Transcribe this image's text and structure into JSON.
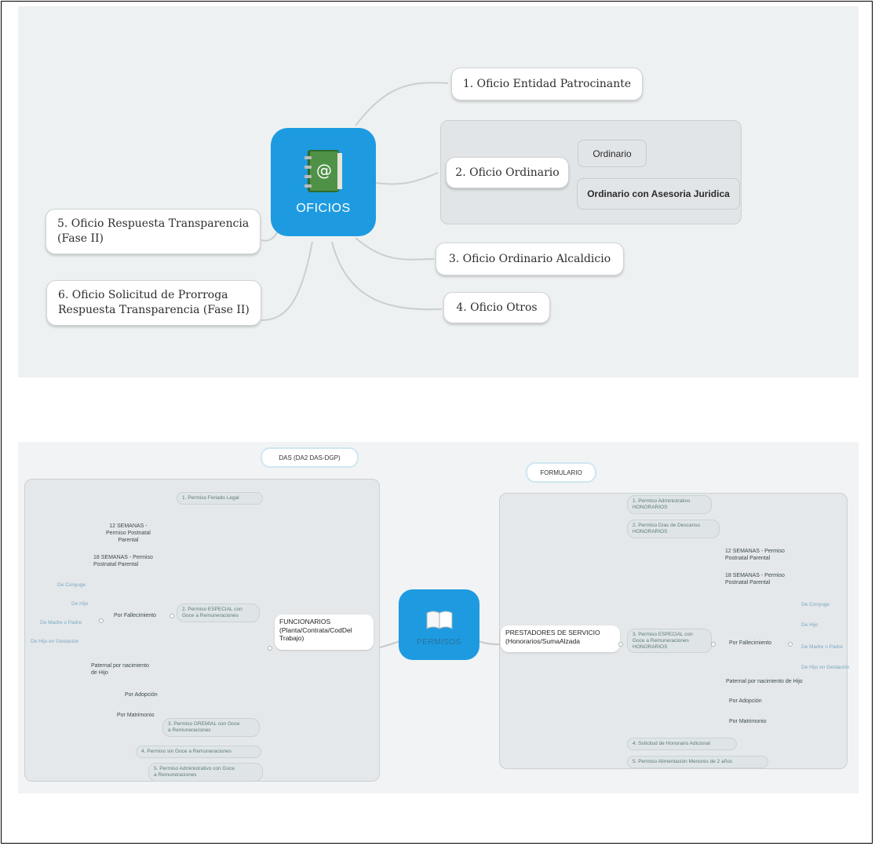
{
  "oficios": {
    "hub_label": "OFICIOS",
    "nodes": {
      "n1": "1. Oficio Entidad Patrocinante",
      "n2": "2. Oficio Ordinario",
      "n3": "3. Oficio Ordinario Alcaldicio",
      "n4": "4. Oficio Otros",
      "n5_line1": "5. Oficio Respuesta Transparencia",
      "n5_line2": "(Fase II)",
      "n6_line1": "6. Oficio Solicitud de Prorroga",
      "n6_line2": "Respuesta Transparencia (Fase II)"
    },
    "ordinario_sub": [
      "Ordinario",
      "Ordinario con Asesoria Juridica"
    ]
  },
  "permisos": {
    "hub_label": "PERMISOS",
    "tag_left": "DAS (DA2 DAS-DGP)",
    "tag_right": "FORMULARIO",
    "left": {
      "root_line1": "FUNCIONARIOS",
      "root_line2": "(Planta/Contrata/CodDel",
      "root_line3": "Trabajo)",
      "p1": "1. Permiso Feriado Legal",
      "p2_line1": "2. Permiso ESPECIAL con",
      "p2_line2": "Goce a Remuneraciones",
      "p3_line1": "3. Permiso GREMIAL con Goce",
      "p3_line2": "a Remuneraciones",
      "p4": "4. Permiso sin Goce a Remuneraciones",
      "p5_line1": "5. Permiso Administrativo con Goce",
      "p5_line2": "a Remuneraciones",
      "s12_line1": "12 SEMANAS -",
      "s12_line2": "Permiso Postnatal",
      "s12_line3": "Parental",
      "s18_line1": "18 SEMANAS - Permiso",
      "s18_line2": "Postnatal Parental",
      "fallecimiento": "Por Fallecimiento",
      "fall_items": [
        "De Conyuge",
        "De Hijo",
        "De Madre o Padre",
        "De Hijo en Gestación"
      ],
      "paternal_line1": "Paternal por nacimiento",
      "paternal_line2": "de Hijo",
      "adopcion": "Por Adopción",
      "matrimonio": "Por Matrimonio"
    },
    "right": {
      "root_line1": "PRESTADORES DE SERVICIO",
      "root_line2": "(Honorarios/SumaAlzada",
      "p1_line1": "1. Permiso Administrativo",
      "p1_line2": "HONORARIOS",
      "p2_line1": "2. Permiso Días de Descanso",
      "p2_line2": "HONORARIOS",
      "p3_line1": "3. Permiso ESPECIAL con",
      "p3_line2": "Goce a Remuneraciones",
      "p3_line3": "HONORARIOS",
      "p4": "4. Solicitud de Honorario Adicional",
      "p5": "5. Permiso Alimentación Menores de 2 años",
      "s12_line1": "12 SEMANAS - Permiso",
      "s12_line2": "Postnatal Parental",
      "s18_line1": "18 SEMANAS - Permiso",
      "s18_line2": "Postnatal Parental",
      "fallecimiento": "Por Fallecimiento",
      "fall_items": [
        "De Conyuge",
        "De Hijo",
        "De Madre o Padre",
        "De Hijo en Gestación"
      ],
      "paternal": "Paternal por nacimiento de Hijo",
      "adopcion": "Por Adopción",
      "matrimonio": "Por Matrimonio"
    }
  },
  "colors": {
    "hub_blue": "#1e9be0",
    "panel_bg": "#eef1f2",
    "book_green": "#3c7a3a",
    "link_gray": "#c9cfd1"
  }
}
